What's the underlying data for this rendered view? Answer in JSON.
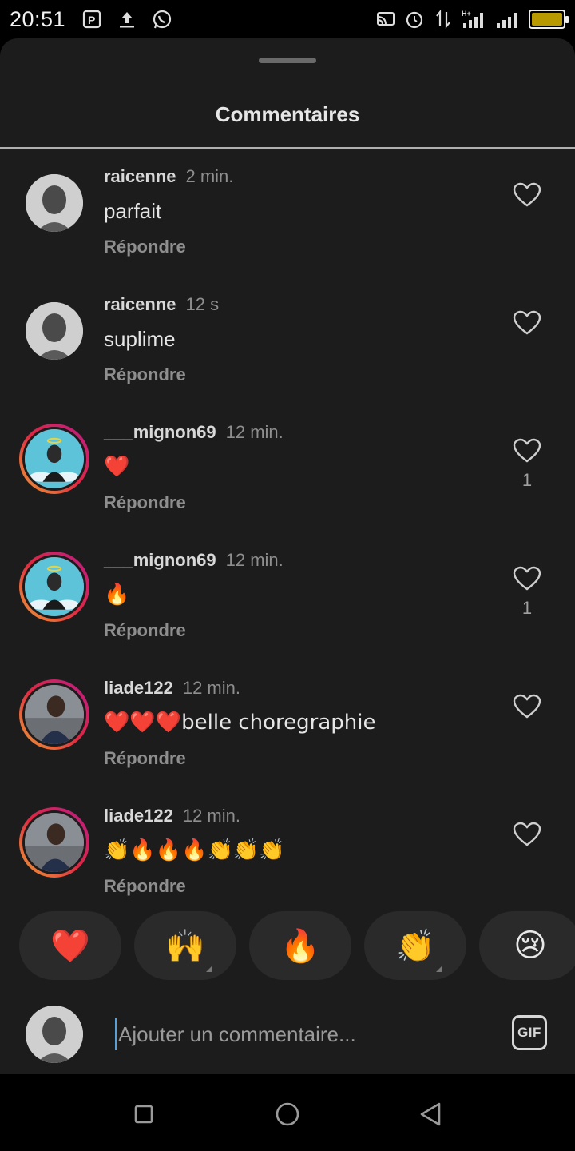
{
  "status_bar": {
    "time": "20:51",
    "left_icons": [
      "parking-icon",
      "upload-icon",
      "whatsapp-icon"
    ],
    "right_icons": [
      "cast-icon",
      "alarm-icon",
      "data-arrows-icon",
      "signal-h-plus-icon",
      "signal-icon",
      "battery-icon"
    ],
    "network_label": "H+",
    "battery_color": "#b89a00"
  },
  "sheet": {
    "title": "Commentaires"
  },
  "comments": [
    {
      "username": "raicenne",
      "time": "2 min.",
      "text": "parfait",
      "reply": "Répondre",
      "likes": "",
      "avatar": "avatar-raicenne"
    },
    {
      "username": "raicenne",
      "time": "12 s",
      "text": "suplime",
      "reply": "Répondre",
      "likes": "",
      "avatar": "avatar-raicenne"
    },
    {
      "username": "___mignon69",
      "time": "12 min.",
      "text": "❤️",
      "reply": "Répondre",
      "likes": "1",
      "avatar": "avatar-mignon69"
    },
    {
      "username": "___mignon69",
      "time": "12 min.",
      "text": "🔥",
      "reply": "Répondre",
      "likes": "1",
      "avatar": "avatar-mignon69"
    },
    {
      "username": "liade122",
      "time": "12 min.",
      "text": "❤️❤️❤️belle choregraphie",
      "reply": "Répondre",
      "likes": "",
      "avatar": "avatar-liade122"
    },
    {
      "username": "liade122",
      "time": "12 min.",
      "text": "👏🔥🔥🔥👏👏👏",
      "reply": "Répondre",
      "likes": "",
      "avatar": "avatar-liade122"
    }
  ],
  "reactions": [
    "❤️",
    "🙌",
    "🔥",
    "👏",
    "😢"
  ],
  "composer": {
    "placeholder": "Ajouter un commentaire...",
    "gif_label": "GIF"
  },
  "nav": {
    "icons": [
      "recent-apps-icon",
      "home-icon",
      "back-icon"
    ]
  },
  "colors": {
    "sheet_bg": "#1c1c1c",
    "reaction_bg": "#2a2a2a",
    "like_red": "#ff3040"
  }
}
